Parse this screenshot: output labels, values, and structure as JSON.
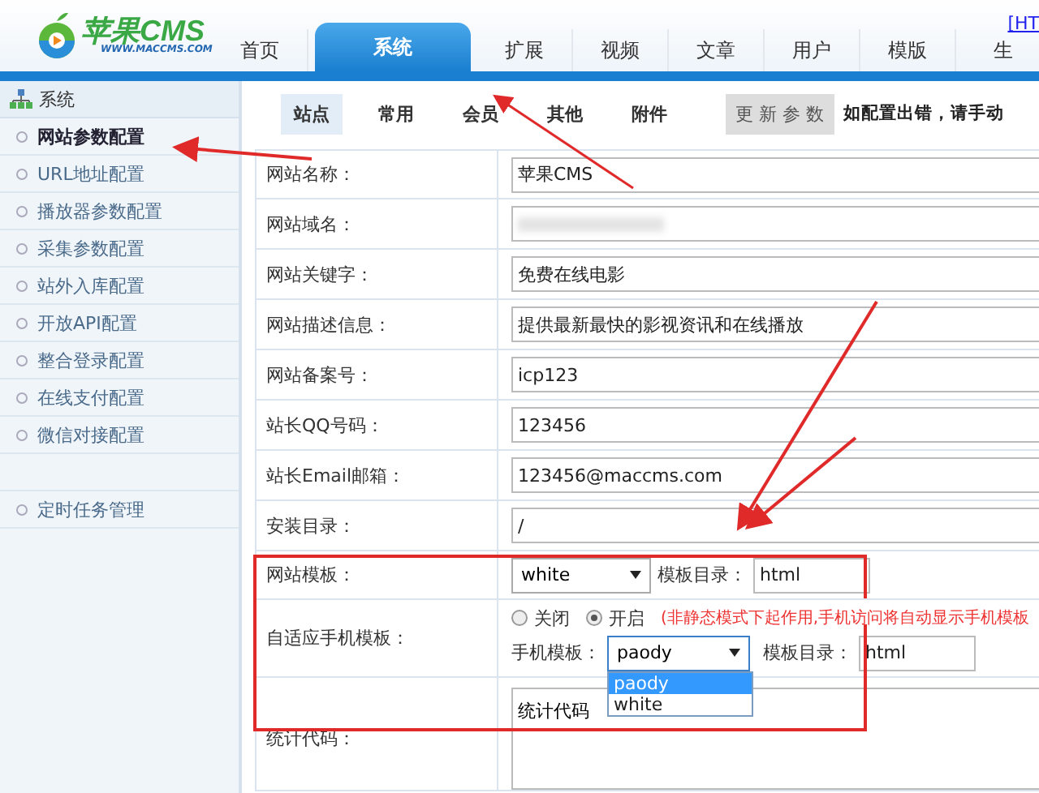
{
  "header": {
    "logo_text": "苹果CMS",
    "logo_url": "WWW.MACCMS.COM",
    "top_link": "[HT",
    "nav": [
      {
        "label": "首页",
        "selected": false
      },
      {
        "label": "系统",
        "selected": true
      },
      {
        "label": "扩展",
        "selected": false
      },
      {
        "label": "视频",
        "selected": false
      },
      {
        "label": "文章",
        "selected": false
      },
      {
        "label": "用户",
        "selected": false
      },
      {
        "label": "模版",
        "selected": false
      },
      {
        "label": "生",
        "selected": false
      }
    ]
  },
  "sidebar": {
    "title": "系统",
    "groups": [
      [
        {
          "label": "网站参数配置",
          "selected": true
        },
        {
          "label": "URL地址配置",
          "selected": false
        },
        {
          "label": "播放器参数配置",
          "selected": false
        },
        {
          "label": "采集参数配置",
          "selected": false
        },
        {
          "label": "站外入库配置",
          "selected": false
        },
        {
          "label": "开放API配置",
          "selected": false
        },
        {
          "label": "整合登录配置",
          "selected": false
        },
        {
          "label": "在线支付配置",
          "selected": false
        },
        {
          "label": "微信对接配置",
          "selected": false
        }
      ],
      [
        {
          "label": "定时任务管理",
          "selected": false
        }
      ]
    ]
  },
  "subtabs": [
    {
      "label": "站点",
      "selected": true
    },
    {
      "label": "常用",
      "selected": false
    },
    {
      "label": "会员",
      "selected": false
    },
    {
      "label": "其他",
      "selected": false
    },
    {
      "label": "附件",
      "selected": false
    }
  ],
  "update_button": "更 新 参 数",
  "notice": "如配置出错，请手动",
  "form": [
    {
      "kind": "text",
      "label": "网站名称：",
      "value": "苹果CMS"
    },
    {
      "kind": "blurred",
      "label": "网站域名："
    },
    {
      "kind": "text",
      "label": "网站关键字：",
      "value": "免费在线电影"
    },
    {
      "kind": "text",
      "label": "网站描述信息：",
      "value": "提供最新最快的影视资讯和在线播放"
    },
    {
      "kind": "text",
      "label": "网站备案号：",
      "value": "icp123"
    },
    {
      "kind": "text",
      "label": "站长QQ号码：",
      "value": "123456"
    },
    {
      "kind": "text",
      "label": "站长Email邮箱：",
      "value": "123456@maccms.com"
    },
    {
      "kind": "text",
      "label": "安装目录：",
      "value": "/"
    },
    {
      "kind": "template",
      "label": "网站模板：",
      "value": "white",
      "dir_label": "模板目录：",
      "dir_value": "html"
    },
    {
      "kind": "mobile",
      "label": "自适应手机模板：",
      "radios": [
        {
          "label": "关闭",
          "selected": false
        },
        {
          "label": "开启",
          "selected": true
        }
      ],
      "note": "(非静态模式下起作用,手机访问将自动显示手机模板",
      "select_label": "手机模板：",
      "value": "paody",
      "expanded": true,
      "options": [
        {
          "label": "paody",
          "selected": true
        },
        {
          "label": "white",
          "selected": false
        }
      ],
      "dir_label": "模板目录：",
      "dir_value": "html"
    },
    {
      "kind": "textarea",
      "label": "统计代码：",
      "value": "统计代码"
    }
  ]
}
